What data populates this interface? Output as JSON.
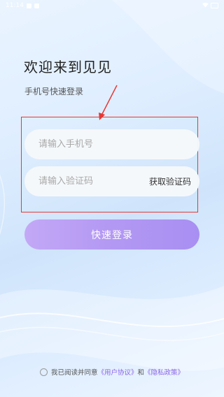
{
  "status_bar": {
    "time": "11:14"
  },
  "header": {
    "title": "欢迎来到见见",
    "subtitle": "手机号快速登录"
  },
  "form": {
    "phone": {
      "value": "",
      "placeholder": "请输入手机号"
    },
    "code": {
      "value": "",
      "placeholder": "请输入验证码",
      "get_code_label": "获取验证码"
    },
    "login_label": "快速登录"
  },
  "agreement": {
    "checked": false,
    "prefix": "我已阅读并同意",
    "user_agreement": "《用户协议》",
    "and": "和",
    "privacy_policy": "《隐私政策》"
  },
  "colors": {
    "accent": "#a88ff2",
    "link": "#8b63e6",
    "annotation": "#e53935"
  }
}
